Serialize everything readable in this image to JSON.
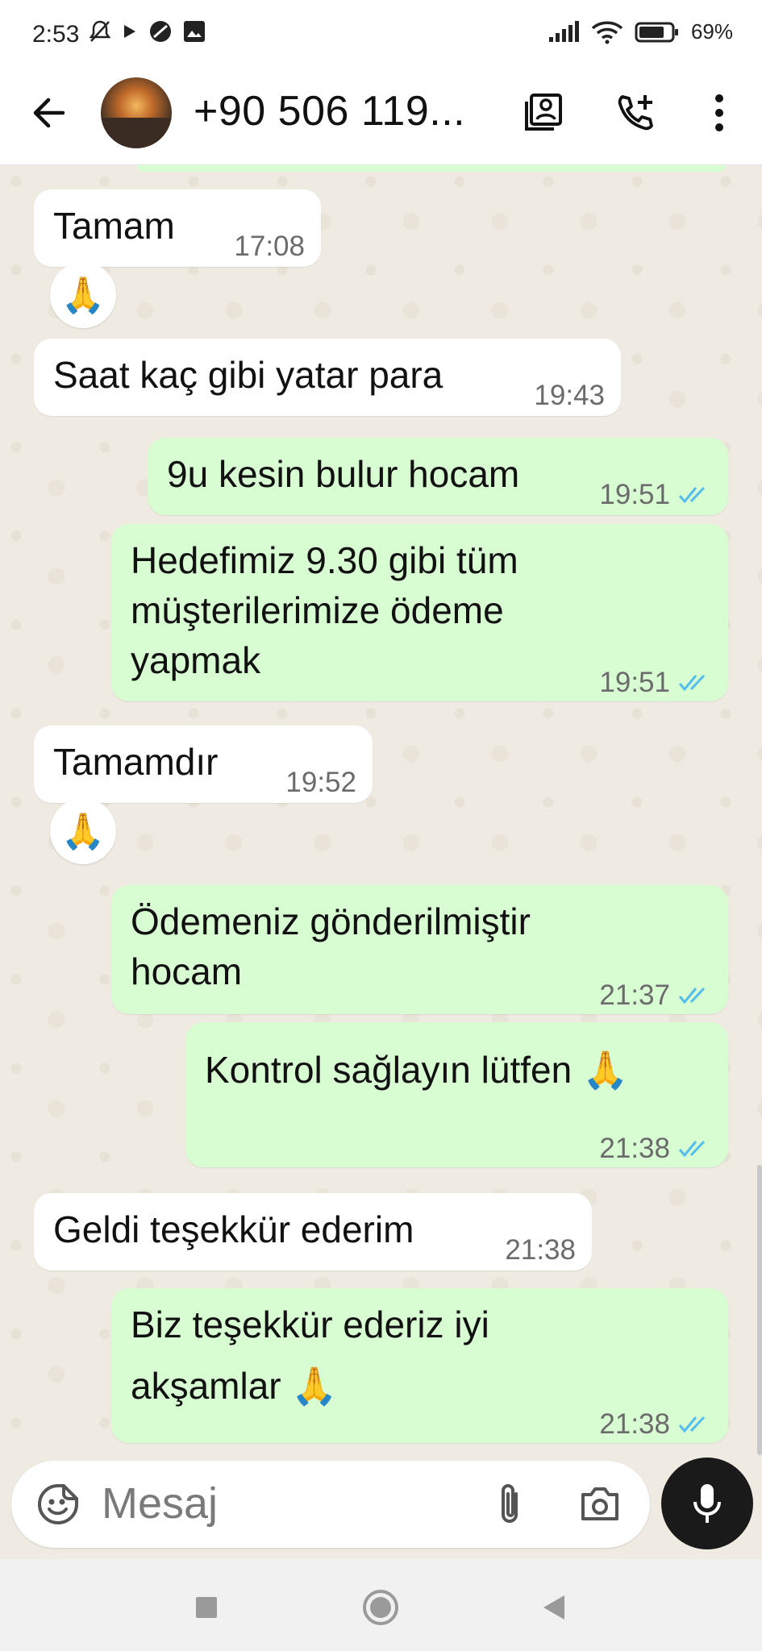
{
  "status_bar": {
    "time": "2:53",
    "battery": "69%",
    "icons": [
      "mute-icon",
      "play-icon",
      "no-entry-icon",
      "image-icon",
      "signal-icon",
      "wifi-icon",
      "battery-icon"
    ]
  },
  "header": {
    "contact_name": "+90 506 119...",
    "icons": [
      "back-arrow-icon",
      "avatar",
      "contact-card-icon",
      "add-call-icon",
      "more-vert-icon"
    ]
  },
  "messages": [
    {
      "dir": "in",
      "lines": [
        "Tamam"
      ],
      "time": "17:08",
      "reaction": "🙏"
    },
    {
      "dir": "in",
      "lines": [
        "Saat kaç gibi yatar para"
      ],
      "time": "19:43"
    },
    {
      "dir": "out",
      "lines": [
        "9u kesin bulur hocam"
      ],
      "time": "19:51",
      "status": "read"
    },
    {
      "dir": "out",
      "lines": [
        "Hedefimiz 9.30 gibi tüm",
        "müşterilerimize ödeme",
        "yapmak"
      ],
      "time": "19:51",
      "status": "read"
    },
    {
      "dir": "in",
      "lines": [
        "Tamamdır"
      ],
      "time": "19:52",
      "reaction": "🙏"
    },
    {
      "dir": "out",
      "lines": [
        "Ödemeniz gönderilmiştir",
        "hocam"
      ],
      "time": "21:37",
      "status": "read"
    },
    {
      "dir": "out",
      "lines": [
        "Kontrol sağlayın lütfen 🙏"
      ],
      "time": "21:38",
      "status": "read"
    },
    {
      "dir": "in",
      "lines": [
        "Geldi teşekkür ederim"
      ],
      "time": "21:38"
    },
    {
      "dir": "out",
      "lines": [
        "Biz teşekkür ederiz iyi",
        "akşamlar 🙏"
      ],
      "time": "21:38",
      "status": "read"
    }
  ],
  "input": {
    "placeholder": "Mesaj",
    "icons": [
      "sticker-icon",
      "attach-icon",
      "camera-icon",
      "mic-icon"
    ]
  },
  "nav_bar": {
    "icons": [
      "recents-square-icon",
      "home-circle-icon",
      "back-triangle-icon"
    ]
  },
  "colors": {
    "incoming": "#ffffff",
    "outgoing": "#d9fdd3",
    "read_ticks": "#53bdeb",
    "chat_bg": "#efeae2"
  }
}
